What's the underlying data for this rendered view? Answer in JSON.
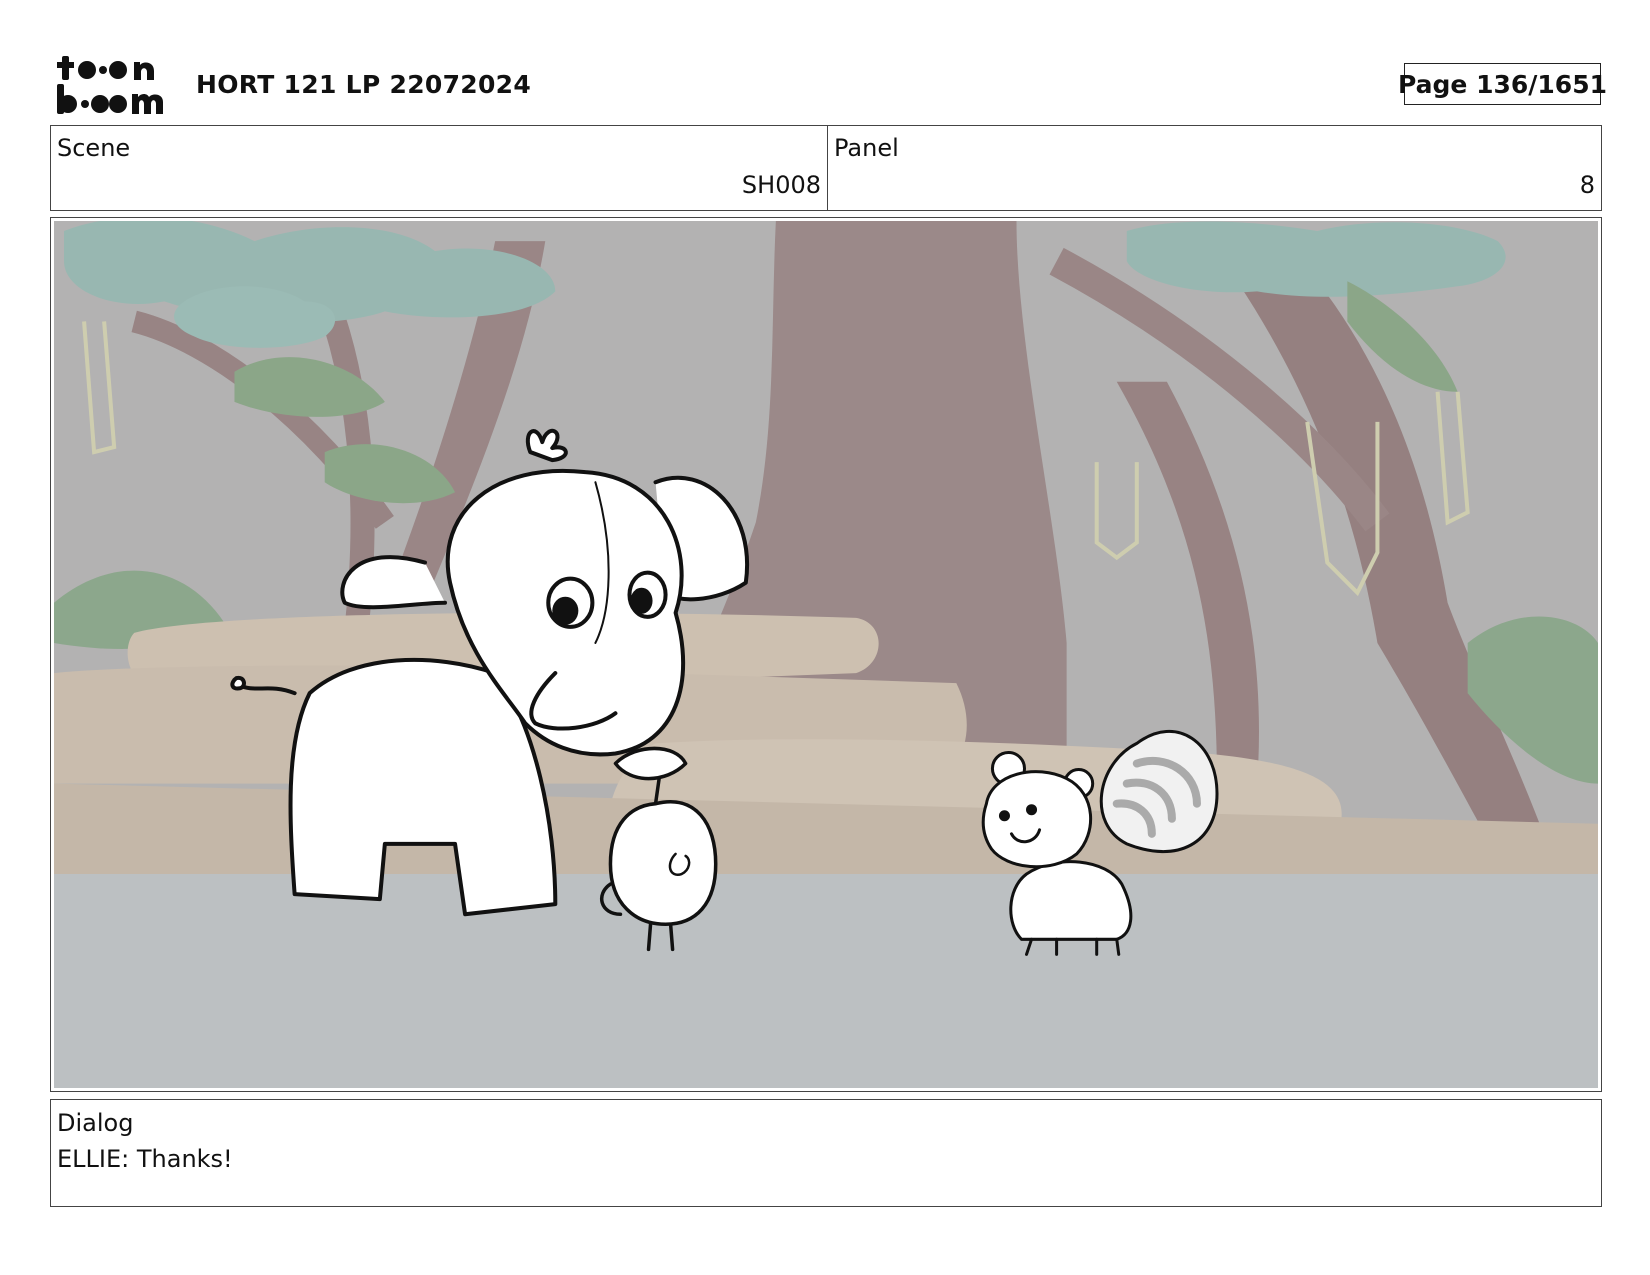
{
  "header": {
    "logo_text": "toonboom",
    "project_title": "HORT 121 LP 22072024",
    "page_label": "Page",
    "page_number": "136/1651"
  },
  "info": {
    "scene_label": "Scene",
    "scene_value": "SH008",
    "panel_label": "Panel",
    "panel_value": "8"
  },
  "dialog": {
    "label": "Dialog",
    "text": "ELLIE: Thanks!"
  },
  "colors": {
    "background_gray": "#a9a8a8",
    "foliage": "#8aaea7",
    "trunk": "#8c7676",
    "rock": "#c7b8a6",
    "ground": "#b3b8ba"
  }
}
